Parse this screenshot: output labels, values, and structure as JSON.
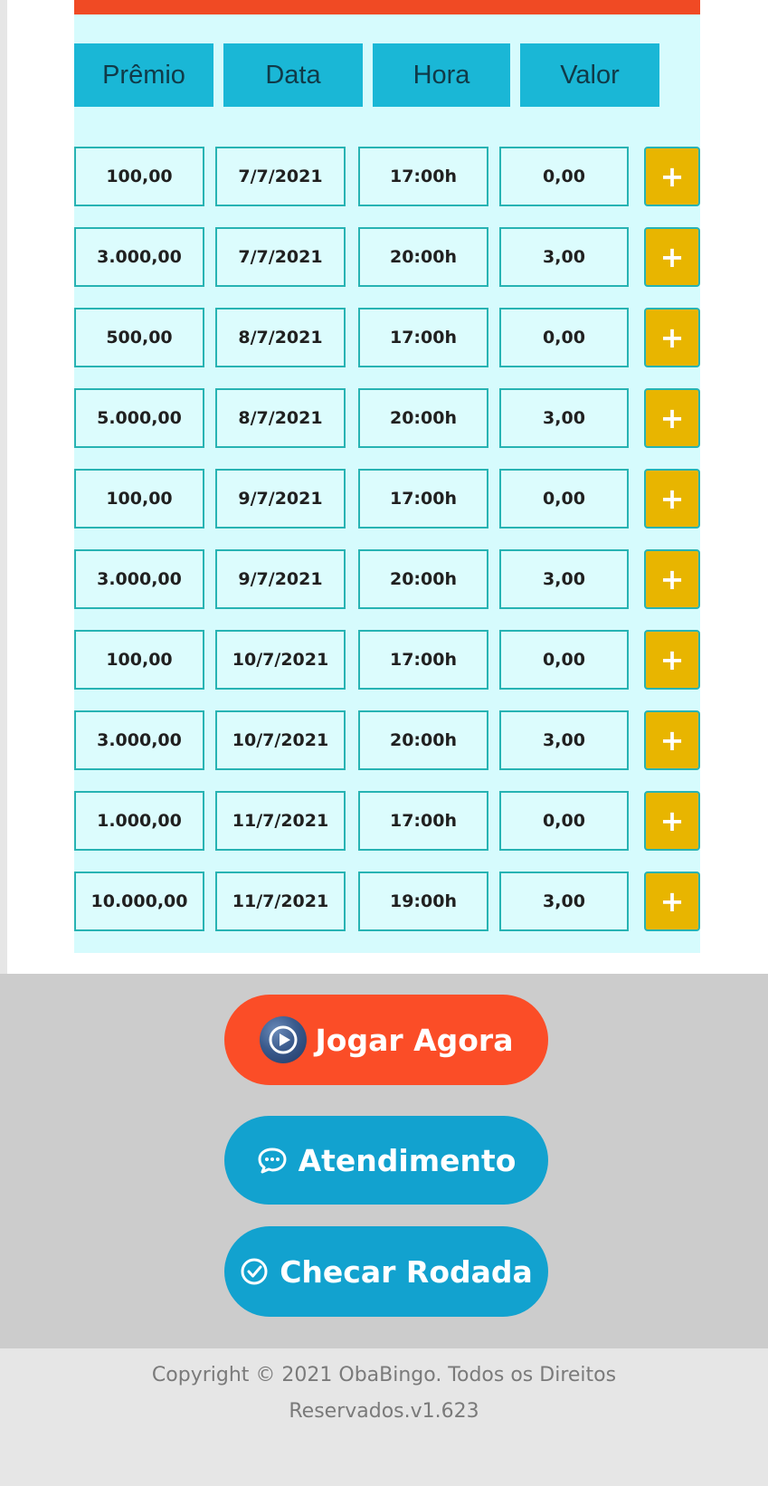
{
  "table": {
    "headers": [
      "Prêmio",
      "Data",
      "Hora",
      "Valor"
    ],
    "add_label": "+",
    "rows": [
      {
        "premio": "100,00",
        "data": "7/7/2021",
        "hora": "17:00h",
        "valor": "0,00"
      },
      {
        "premio": "3.000,00",
        "data": "7/7/2021",
        "hora": "20:00h",
        "valor": "3,00"
      },
      {
        "premio": "500,00",
        "data": "8/7/2021",
        "hora": "17:00h",
        "valor": "0,00"
      },
      {
        "premio": "5.000,00",
        "data": "8/7/2021",
        "hora": "20:00h",
        "valor": "3,00"
      },
      {
        "premio": "100,00",
        "data": "9/7/2021",
        "hora": "17:00h",
        "valor": "0,00"
      },
      {
        "premio": "3.000,00",
        "data": "9/7/2021",
        "hora": "20:00h",
        "valor": "3,00"
      },
      {
        "premio": "100,00",
        "data": "10/7/2021",
        "hora": "17:00h",
        "valor": "0,00"
      },
      {
        "premio": "3.000,00",
        "data": "10/7/2021",
        "hora": "20:00h",
        "valor": "3,00"
      },
      {
        "premio": "1.000,00",
        "data": "11/7/2021",
        "hora": "17:00h",
        "valor": "0,00"
      },
      {
        "premio": "10.000,00",
        "data": "11/7/2021",
        "hora": "19:00h",
        "valor": "3,00"
      }
    ]
  },
  "actions": {
    "play_label": "Jogar Agora",
    "support_label": "Atendimento",
    "check_label": "Checar Rodada"
  },
  "icons": {
    "play": "play-circle-icon",
    "support": "chat-bubble-icon",
    "check": "check-circle-icon",
    "add": "plus-icon"
  },
  "colors": {
    "accent_red": "#fb4d27",
    "accent_blue": "#12a2cf",
    "header_cyan": "#1ab7d6",
    "add_yellow": "#e8b500"
  },
  "footer": {
    "line1": "Copyright © 2021 ObaBingo. Todos os Direitos",
    "line2": "Reservados.v1.623"
  }
}
